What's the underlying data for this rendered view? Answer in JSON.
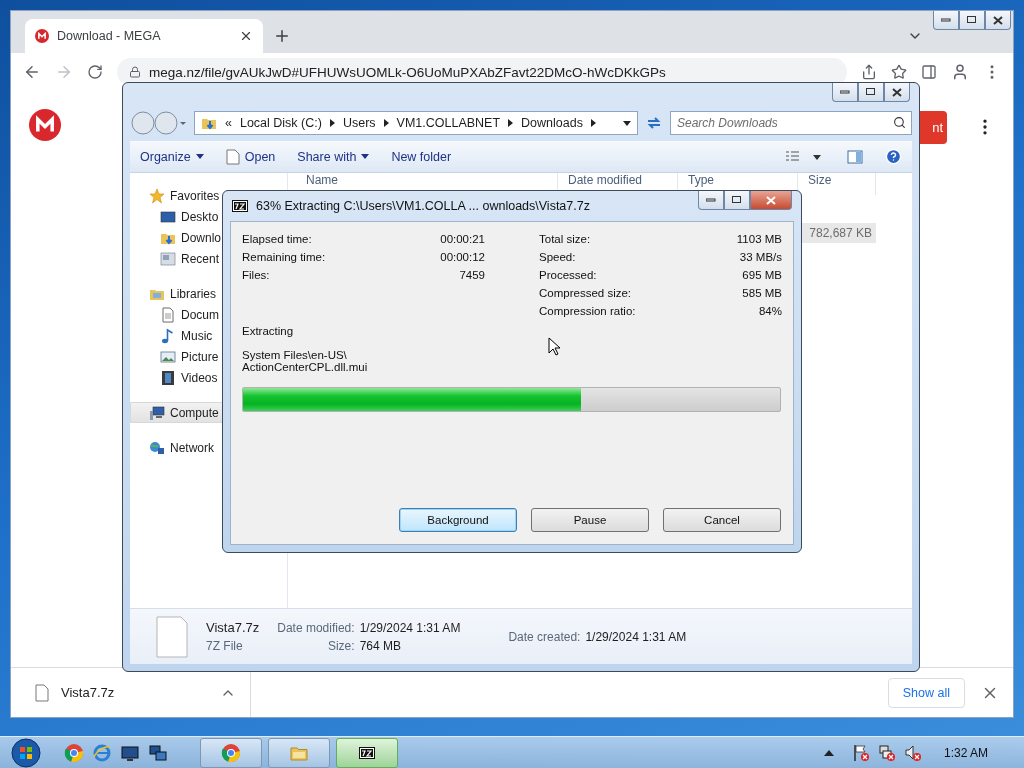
{
  "browser": {
    "tab": {
      "title": "Download - MEGA",
      "selected": true
    },
    "address": "mega.nz/file/gvAUkJwD#UFHUWsUOMLk-O6UoMuPXAbZFavt22DMcO-hWcDKkGPs",
    "page_button": "nt",
    "download": {
      "file": "Vista7.7z"
    },
    "show_all": "Show all"
  },
  "explorer": {
    "breadcrumb_prefix": "«",
    "breadcrumb": [
      "Local Disk (C:)",
      "Users",
      "VM1.COLLABNET",
      "Downloads"
    ],
    "search": {
      "placeholder": "Search Downloads"
    },
    "commands": [
      {
        "label": "Organize",
        "kind": "menu"
      },
      {
        "label": "Open",
        "kind": "file"
      },
      {
        "label": "Share with",
        "kind": "menu"
      },
      {
        "label": "New folder",
        "kind": "plain"
      }
    ],
    "nav": [
      {
        "label": "Favorites",
        "kind": "star",
        "selected": false,
        "children": [
          {
            "label": "Deskto",
            "kind": "desktop",
            "selected": false
          },
          {
            "label": "Downlo",
            "kind": "downloads",
            "selected": false
          },
          {
            "label": "Recent",
            "kind": "recent",
            "selected": false
          }
        ]
      },
      {
        "label": "Libraries",
        "kind": "libraries",
        "selected": false,
        "children": [
          {
            "label": "Docum",
            "kind": "document",
            "selected": false
          },
          {
            "label": "Music",
            "kind": "music",
            "selected": false
          },
          {
            "label": "Picture",
            "kind": "pictures",
            "selected": false
          },
          {
            "label": "Videos",
            "kind": "videos",
            "selected": false
          }
        ]
      },
      {
        "label": "Compute",
        "kind": "computer",
        "selected": true
      },
      {
        "label": "Network",
        "kind": "network",
        "selected": false
      }
    ],
    "columns": [
      "Name",
      "Date modified",
      "Type",
      "Size"
    ],
    "rows": [
      {
        "size": "782,687 KB",
        "selected": true
      }
    ],
    "details": {
      "name": "Vista7.7z",
      "type": "7Z File",
      "columns": [
        [
          {
            "label": "Date modified:",
            "value": "1/29/2024 1:31 AM"
          },
          {
            "label": "Size:",
            "value": "764 MB"
          }
        ],
        [
          {
            "label": "Date created:",
            "value": "1/29/2024 1:31 AM"
          }
        ]
      ]
    }
  },
  "dialog": {
    "title": "63% Extracting C:\\Users\\VM1.COLLA ... ownloads\\Vista7.7z",
    "left": [
      {
        "label": "Elapsed time:",
        "value": "00:00:21"
      },
      {
        "label": "Remaining time:",
        "value": "00:00:12"
      },
      {
        "label": "Files:",
        "value": "7459"
      }
    ],
    "right": [
      {
        "label": "Total size:",
        "value": "1103 MB"
      },
      {
        "label": "Speed:",
        "value": "33 MB/s"
      },
      {
        "label": "Processed:",
        "value": "695 MB"
      },
      {
        "label": "Compressed size:",
        "value": "585 MB"
      },
      {
        "label": "Compression ratio:",
        "value": "84%"
      }
    ],
    "status": "Extracting",
    "path": [
      "System Files\\en-US\\",
      "ActionCenterCPL.dll.mui"
    ],
    "level": 0.63,
    "buttons": [
      {
        "label": "Background",
        "focused": true
      },
      {
        "label": "Pause",
        "focused": false
      },
      {
        "label": "Cancel",
        "focused": false
      }
    ]
  },
  "taskbar": {
    "pinned": [
      {
        "kind": "chrome"
      },
      {
        "kind": "ie"
      },
      {
        "kind": "desktop"
      },
      {
        "kind": "network"
      }
    ],
    "tasks": [
      {
        "kind": "chrome",
        "selected": false
      },
      {
        "kind": "explorer",
        "selected": false
      },
      {
        "kind": "sevenzip",
        "selected": true
      }
    ],
    "tray": [
      {
        "kind": "flag"
      },
      {
        "kind": "network"
      },
      {
        "kind": "speaker"
      }
    ],
    "clock": "1:32 AM"
  }
}
